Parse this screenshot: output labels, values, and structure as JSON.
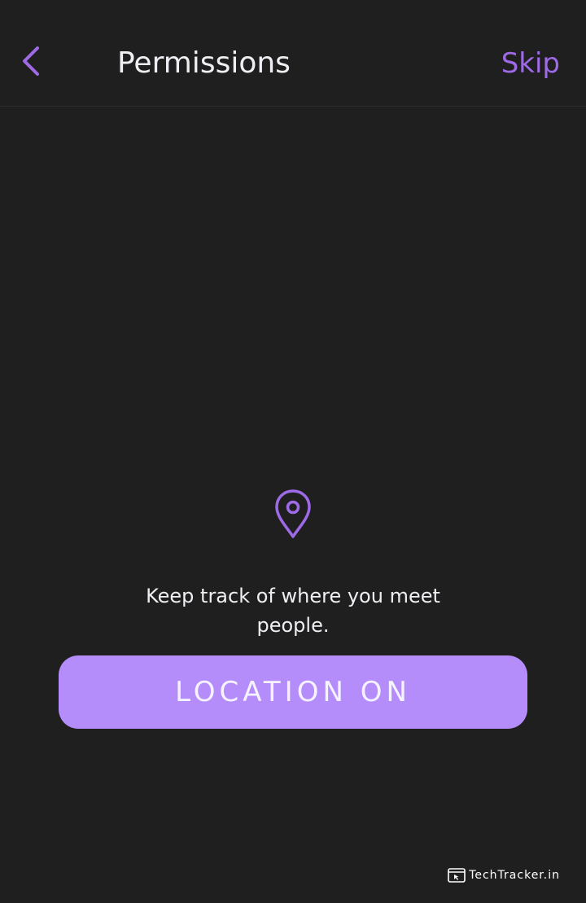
{
  "header": {
    "title": "Permissions",
    "skip_label": "Skip"
  },
  "main": {
    "icon": "location-pin-icon",
    "description_line1": "Keep track of where you meet",
    "description_line2": "people.",
    "button_label": "LOCATION ON"
  },
  "watermark": {
    "text": "TechTracker.in"
  },
  "colors": {
    "background": "#1f1f20",
    "accent": "#9e6ae6",
    "button": "#b48dfb",
    "text": "#efeef2"
  }
}
